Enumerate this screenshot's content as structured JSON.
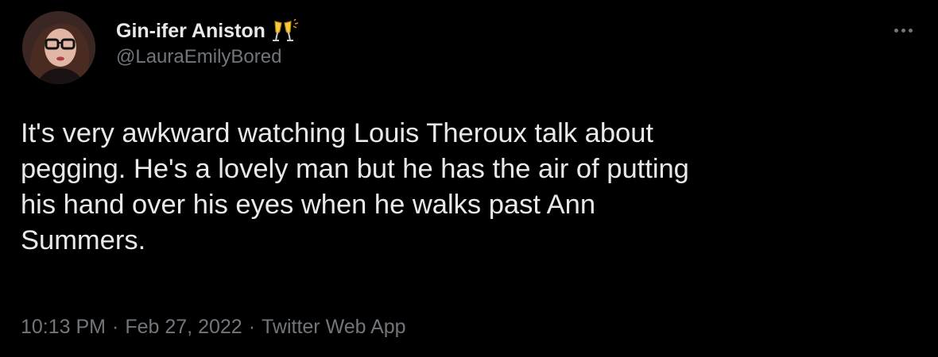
{
  "author": {
    "display_name": "Gin-ifer Aniston",
    "handle": "@LauraEmilyBored",
    "name_emoji": "clinking-glasses-icon",
    "verified": false
  },
  "menu": {
    "icon": "more-horizontal-icon"
  },
  "tweet": {
    "text": "It's very awkward watching Louis Theroux talk about\npegging. He's a lovely man but he has the air of putting\nhis hand over his eyes when he walks past Ann\nSummers."
  },
  "meta": {
    "time": "10:13 PM",
    "date": "Feb 27, 2022",
    "source": "Twitter Web App",
    "separator": "·"
  },
  "colors": {
    "background": "#000000",
    "text_primary": "#e7e9ea",
    "text_secondary": "#71767b"
  }
}
